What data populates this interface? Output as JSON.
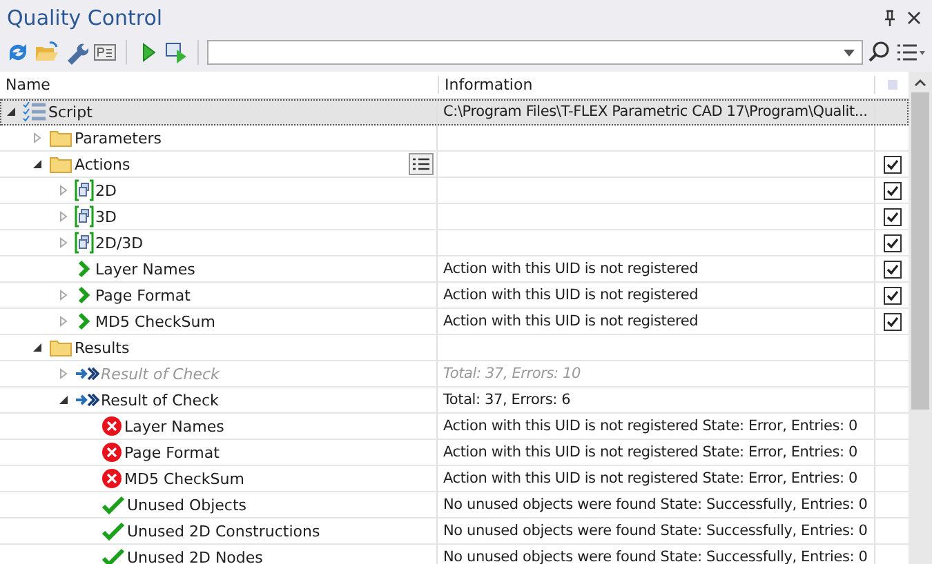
{
  "window": {
    "title": "Quality Control"
  },
  "columns": [
    "Name",
    "Information"
  ],
  "tree": [
    {
      "name": "Script",
      "kind": "script",
      "expanded": true,
      "selected": true,
      "info": "C:\\Program Files\\T-FLEX Parametric CAD 17\\Program\\Qualit...",
      "children": [
        {
          "name": "Parameters",
          "kind": "folder",
          "expanded": false,
          "selected": false
        },
        {
          "name": "Actions",
          "kind": "folder",
          "expanded": true,
          "selected": false,
          "options_button": true,
          "checked": true,
          "children": [
            {
              "name": "2D",
              "kind": "group",
              "expanded": false,
              "selected": false,
              "checked": true
            },
            {
              "name": "3D",
              "kind": "group",
              "expanded": false,
              "selected": false,
              "checked": true
            },
            {
              "name": "2D/3D",
              "kind": "group",
              "expanded": false,
              "selected": false,
              "checked": true
            },
            {
              "name": "Layer Names",
              "kind": "action",
              "selected": false,
              "info": "Action with this UID is not registered",
              "checked": true
            },
            {
              "name": "Page Format",
              "kind": "action",
              "expanded": false,
              "selected": false,
              "info": "Action with this UID is not registered",
              "checked": true
            },
            {
              "name": "MD5 CheckSum",
              "kind": "action",
              "expanded": false,
              "selected": false,
              "info": "Action with this UID is not registered",
              "checked": true
            }
          ]
        },
        {
          "name": "Results",
          "kind": "folder",
          "expanded": true,
          "selected": false,
          "children": [
            {
              "name": "Result of Check",
              "kind": "result",
              "expanded": false,
              "selected": false,
              "disabled": true,
              "info": "Total: 37, Errors: 10"
            },
            {
              "name": "Result of Check",
              "kind": "result",
              "expanded": true,
              "selected": false,
              "disabled": false,
              "info": "Total: 37, Errors: 6",
              "children": [
                {
                  "name": "Layer Names",
                  "kind": "error",
                  "selected": false,
                  "info": "Action with this UID is not registered State: Error, Entries: 0"
                },
                {
                  "name": "Page Format",
                  "kind": "error",
                  "selected": false,
                  "info": "Action with this UID is not registered State: Error, Entries: 0"
                },
                {
                  "name": "MD5 CheckSum",
                  "kind": "error",
                  "selected": false,
                  "info": "Action with this UID is not registered State: Error, Entries: 0"
                },
                {
                  "name": "Unused Objects",
                  "kind": "ok",
                  "selected": false,
                  "info": "No unused objects were found State: Successfully, Entries: 0"
                },
                {
                  "name": "Unused 2D Constructions",
                  "kind": "ok",
                  "selected": false,
                  "info": "No unused objects were found State: Successfully, Entries: 0"
                },
                {
                  "name": "Unused 2D Nodes",
                  "kind": "ok",
                  "selected": false,
                  "info": "No unused objects were found State: Successfully, Entries: 0"
                }
              ]
            }
          ]
        }
      ]
    }
  ]
}
